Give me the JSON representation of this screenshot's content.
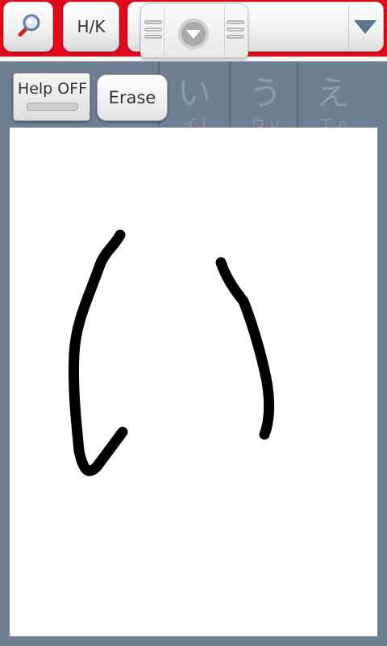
{
  "toolbar": {
    "search_icon": "magnifier-icon",
    "hk_label": "H/K",
    "dropdown_value": "",
    "dropdown_icon": "triangle-down-icon",
    "handle_icon": "circle-chevron-down-icon"
  },
  "kana_strip": {
    "columns": [
      {
        "kana": "い",
        "romaji": "イ i"
      },
      {
        "kana": "う",
        "romaji": "ウ u"
      },
      {
        "kana": "え",
        "romaji": "エ e"
      }
    ]
  },
  "controls": {
    "help_label": "Help OFF",
    "erase_label": "Erase"
  },
  "colors": {
    "toolbar_red": "#e3081a",
    "background": "#6e7f94",
    "canvas": "#ffffff",
    "ink": "#000000"
  }
}
